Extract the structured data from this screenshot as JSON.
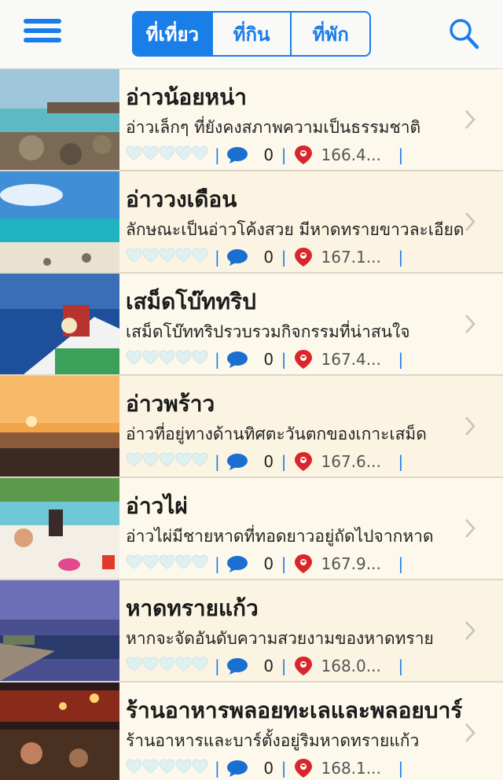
{
  "header": {
    "tabs": [
      {
        "label": "ที่เที่ยว",
        "active": true
      },
      {
        "label": "ที่กิน",
        "active": false
      },
      {
        "label": "ที่พัก",
        "active": false
      }
    ],
    "accent_color": "#1a7ee8"
  },
  "icons": {
    "menu": "hamburger-menu-icon",
    "search": "search-icon",
    "rating": "heart-icon",
    "comments": "speech-bubble-icon",
    "distance": "location-pin-icon",
    "disclosure": "chevron-right-icon"
  },
  "places": [
    {
      "title": "อ่าวน้อยหน่า",
      "description": "อ่าวเล็กๆ ที่ยังคงสภาพความเป็นธรรมชาติ",
      "comments": "0",
      "distance": "166.4...",
      "separator": "|",
      "rating": 0
    },
    {
      "title": "อ่าววงเดือน",
      "description": "ลักษณะเป็นอ่าวโค้งสวย มีหาดทรายขาวละเอียด",
      "comments": "0",
      "distance": "167.1...",
      "separator": "|",
      "rating": 0
    },
    {
      "title": "เสม็ดโบ๊ททริป",
      "description": "เสม็ดโบ๊ททริปรวบรวมกิจกรรมที่น่าสนใจ",
      "comments": "0",
      "distance": "167.4...",
      "separator": "|",
      "rating": 0
    },
    {
      "title": "อ่าวพร้าว",
      "description": "อ่าวที่อยู่ทางด้านทิศตะวันตกของเกาะเสม็ด",
      "comments": "0",
      "distance": "167.6...",
      "separator": "|",
      "rating": 0
    },
    {
      "title": "อ่าวไผ่",
      "description": "อ่าวไผ่มีชายหาดที่ทอดยาวอยู่ถัดไปจากหาด",
      "comments": "0",
      "distance": "167.9...",
      "separator": "|",
      "rating": 0
    },
    {
      "title": "หาดทรายแก้ว",
      "description": "หากจะจัดอันดับความสวยงามของหาดทราย",
      "comments": "0",
      "distance": "168.0...",
      "separator": "|",
      "rating": 0
    },
    {
      "title": "ร้านอาหารพลอยทะเลและพลอยบาร์",
      "description": "ร้านอาหารและบาร์ตั้งอยู่ริมหาดทรายแก้ว",
      "comments": "0",
      "distance": "168.1...",
      "separator": "|",
      "rating": 0
    }
  ]
}
